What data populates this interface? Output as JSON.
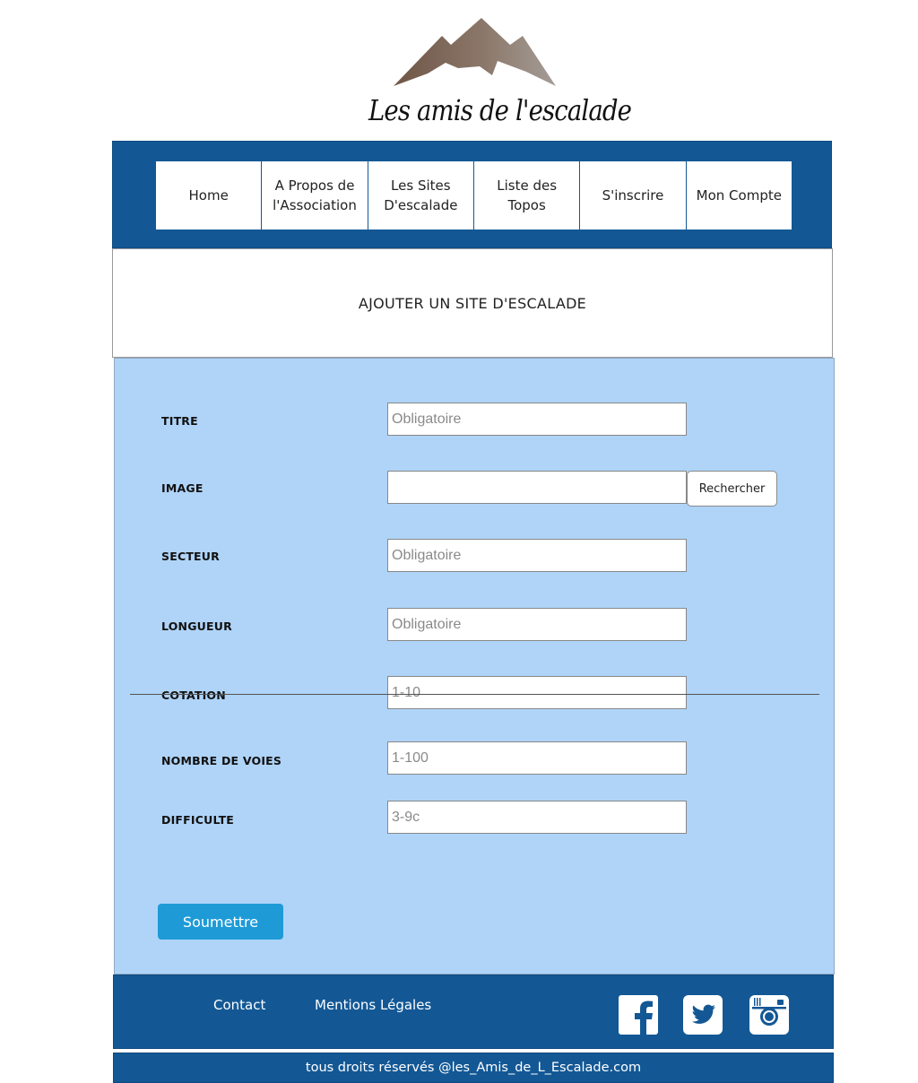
{
  "brand": {
    "name": "Les amis de l'escalade"
  },
  "nav": {
    "items": [
      {
        "label": "Home"
      },
      {
        "label": "A Propos de\nl'Association"
      },
      {
        "label": "Les Sites\nD'escalade"
      },
      {
        "label": "Liste des\nTopos"
      },
      {
        "label": "S'inscrire"
      },
      {
        "label": "Mon Compte"
      }
    ]
  },
  "page": {
    "title": "AJOUTER UN SITE D'ESCALADE"
  },
  "form": {
    "fields": [
      {
        "label": "TITRE",
        "placeholder": "Obligatoire"
      },
      {
        "label": "IMAGE",
        "placeholder": ""
      },
      {
        "label": "SECTEUR",
        "placeholder": "Obligatoire"
      },
      {
        "label": "LONGUEUR",
        "placeholder": "Obligatoire"
      },
      {
        "label": "COTATION",
        "placeholder": "1-10"
      },
      {
        "label": "NOMBRE DE VOIES",
        "placeholder": "1-100"
      },
      {
        "label": "DIFFICULTE",
        "placeholder": "3-9c"
      }
    ],
    "browse_label": "Rechercher",
    "submit_label": "Soumettre"
  },
  "footer": {
    "links": [
      {
        "label": "Contact"
      },
      {
        "label": "Mentions Légales"
      }
    ],
    "social": [
      "facebook-icon",
      "twitter-icon",
      "instagram-icon"
    ],
    "copyright": "tous droits réservés @les_Amis_de_L_Escalade.com"
  },
  "colors": {
    "nav_bg": "#135895",
    "form_bg": "#afd4f8",
    "submit": "#1e9bd7"
  }
}
